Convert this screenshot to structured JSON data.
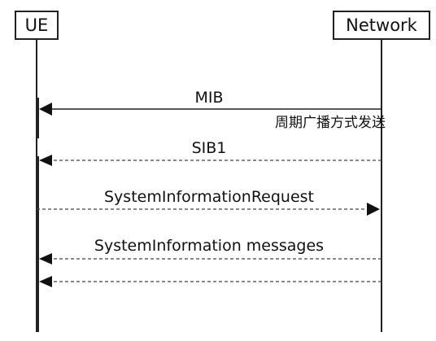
{
  "participants": {
    "ue": "UE",
    "network": "Network"
  },
  "messages": [
    {
      "label": "MIB",
      "direction": "network-to-ue",
      "style": "solid"
    },
    {
      "label": "SIB1",
      "direction": "network-to-ue",
      "style": "dashed"
    },
    {
      "label": "SystemInformationRequest",
      "direction": "ue-to-network",
      "style": "dashed"
    },
    {
      "label": "SystemInformation messages",
      "direction": "network-to-ue",
      "style": "dashed"
    },
    {
      "label": "",
      "direction": "network-to-ue",
      "style": "dashed"
    }
  ],
  "note": "周期广播方式发送",
  "colors": {
    "line": "#222222",
    "text": "#111111",
    "box_border": "#222222",
    "background": "#ffffff"
  }
}
